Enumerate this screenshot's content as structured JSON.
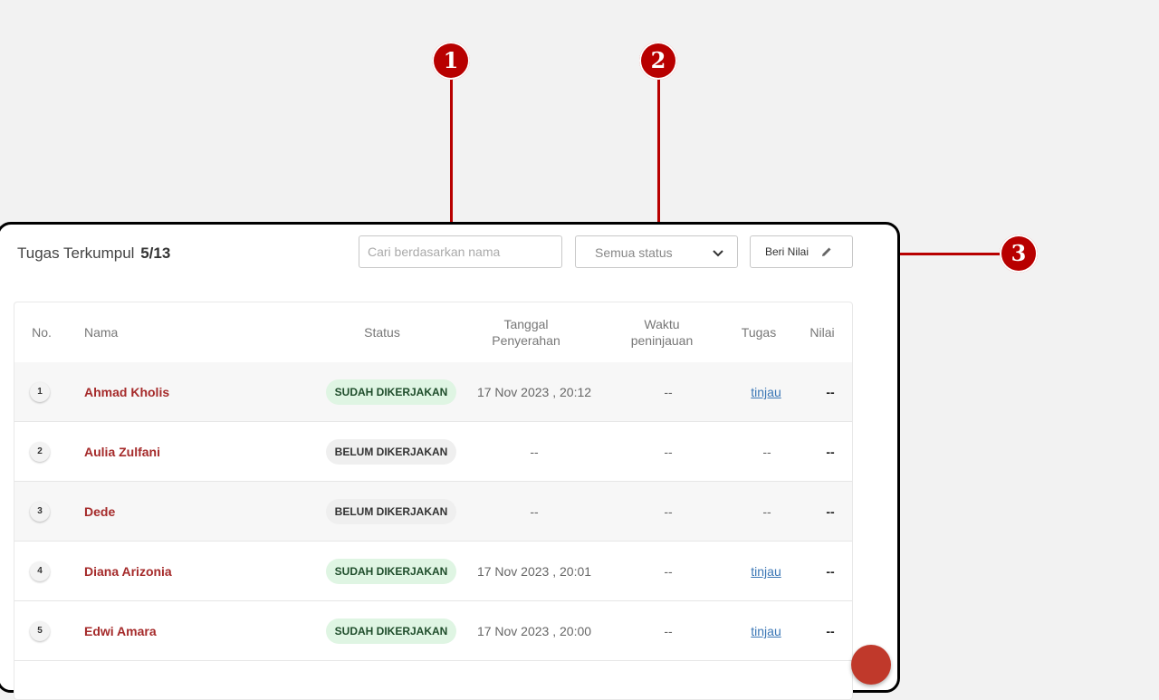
{
  "header": {
    "summary_label": "Tugas Terkumpul",
    "summary_count": "5/13",
    "search_placeholder": "Cari berdasarkan nama",
    "status_filter": "Semua status",
    "grade_button": "Beri Nilai"
  },
  "table": {
    "columns": {
      "no": "No.",
      "name": "Nama",
      "status": "Status",
      "date_line1": "Tanggal",
      "date_line2": "Penyerahan",
      "review_line1": "Waktu",
      "review_line2": "peninjauan",
      "task": "Tugas",
      "score": "Nilai"
    },
    "rows": [
      {
        "no": "1",
        "name": "Ahmad Kholis",
        "status": "SUDAH DIKERJAKAN",
        "date": "17 Nov 2023 , 20:12",
        "review": "--",
        "task": "tinjau",
        "score": "--"
      },
      {
        "no": "2",
        "name": "Aulia Zulfani",
        "status": "BELUM DIKERJAKAN",
        "date": "--",
        "review": "--",
        "task": "--",
        "score": "--"
      },
      {
        "no": "3",
        "name": "Dede",
        "status": "BELUM DIKERJAKAN",
        "date": "--",
        "review": "--",
        "task": "--",
        "score": "--"
      },
      {
        "no": "4",
        "name": "Diana Arizonia",
        "status": "SUDAH DIKERJAKAN",
        "date": "17 Nov 2023 , 20:01",
        "review": "--",
        "task": "tinjau",
        "score": "--"
      },
      {
        "no": "5",
        "name": "Edwi Amara",
        "status": "SUDAH DIKERJAKAN",
        "date": "17 Nov 2023 , 20:00",
        "review": "--",
        "task": "tinjau",
        "score": "--"
      }
    ]
  },
  "annotations": [
    "1",
    "2",
    "3"
  ],
  "colors": {
    "accent": "#b80000",
    "name": "#a52a2a",
    "done_badge": "#dff5e3",
    "todo_badge": "#efefef",
    "link": "#3a76b5"
  }
}
